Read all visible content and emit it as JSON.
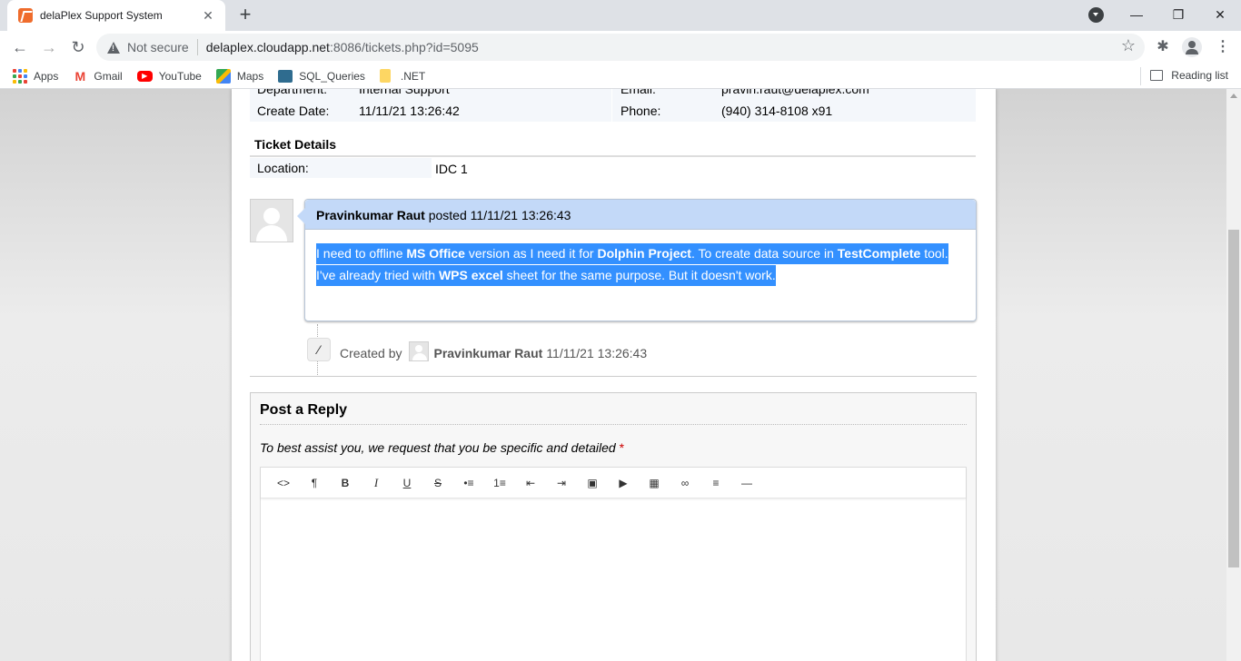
{
  "browser": {
    "tab_title": "delaPlex Support System",
    "new_tab": "+",
    "not_secure": "Not secure",
    "url_host": "delaplex.cloudapp.net",
    "url_rest": ":8086/tickets.php?id=5095",
    "bookmarks": [
      "Apps",
      "Gmail",
      "YouTube",
      "Maps",
      "SQL_Queries",
      ".NET"
    ],
    "reading_list": "Reading list"
  },
  "ticket_info": {
    "department_label": "Department:",
    "department_value": "Internal Support",
    "email_label": "Email:",
    "email_value": "pravin.raut@delaplex.com",
    "create_date_label": "Create Date:",
    "create_date_value": "11/11/21 13:26:42",
    "phone_label": "Phone:",
    "phone_value": "(940) 314-8108 x91"
  },
  "ticket_details": {
    "title": "Ticket Details",
    "location_label": "Location:",
    "location_value": "IDC 1"
  },
  "thread": {
    "author": "Pravinkumar Raut",
    "posted_word": "posted",
    "posted_at": "11/11/21 13:26:43",
    "line1": {
      "p1": "I need to offline ",
      "b1": "MS Office",
      "p2": " version as I need it for ",
      "b2": "Dolphin Project",
      "p3": ". To create data source in ",
      "b3": "TestComplete",
      "p4": " tool."
    },
    "line2": {
      "p1": "I've already tried with ",
      "b1": "WPS excel",
      "p2": " sheet for the same purpose. But it doesn't work."
    }
  },
  "event": {
    "created_by": "Created by",
    "author": "Pravinkumar Raut",
    "time": "11/11/21 13:26:43"
  },
  "reply": {
    "title": "Post a Reply",
    "hint": "To best assist you, we request that you be specific and detailed",
    "required_mark": "*"
  },
  "editor_toolbar": [
    {
      "name": "html-code",
      "glyph": "<>"
    },
    {
      "name": "paragraph",
      "glyph": "¶"
    },
    {
      "name": "bold",
      "glyph": "B"
    },
    {
      "name": "italic",
      "glyph": "I"
    },
    {
      "name": "underline",
      "glyph": "U"
    },
    {
      "name": "strikethrough",
      "glyph": "S"
    },
    {
      "name": "unordered-list",
      "glyph": "•≡"
    },
    {
      "name": "ordered-list",
      "glyph": "1≡"
    },
    {
      "name": "outdent",
      "glyph": "⇤"
    },
    {
      "name": "indent",
      "glyph": "⇥"
    },
    {
      "name": "image",
      "glyph": "▣"
    },
    {
      "name": "video",
      "glyph": "▶"
    },
    {
      "name": "table",
      "glyph": "▦"
    },
    {
      "name": "link",
      "glyph": "∞"
    },
    {
      "name": "align",
      "glyph": "≡"
    },
    {
      "name": "horizontal-rule",
      "glyph": "—"
    }
  ]
}
